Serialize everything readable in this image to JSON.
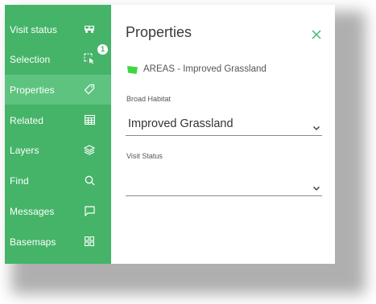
{
  "sidebar": {
    "items": [
      {
        "label": "Visit status",
        "icon": "van-icon",
        "active": false
      },
      {
        "label": "Selection",
        "icon": "select-cursor-icon",
        "active": false,
        "badge": "1"
      },
      {
        "label": "Properties",
        "icon": "tag-icon",
        "active": true
      },
      {
        "label": "Related",
        "icon": "table-icon",
        "active": false
      },
      {
        "label": "Layers",
        "icon": "layers-icon",
        "active": false
      },
      {
        "label": "Find",
        "icon": "search-icon",
        "active": false
      },
      {
        "label": "Messages",
        "icon": "message-icon",
        "active": false
      },
      {
        "label": "Basemaps",
        "icon": "grid-icon",
        "active": false
      }
    ]
  },
  "panel": {
    "title": "Properties",
    "layer_name": "AREAS - Improved Grassland",
    "fields": [
      {
        "label": "Broad Habitat",
        "value": "Improved Grassland"
      },
      {
        "label": "Visit Status",
        "value": ""
      }
    ]
  },
  "colors": {
    "sidebar": "#45b468",
    "sidebar_active": "#5ec37f",
    "accent": "#3cb371",
    "layer_swatch": "#3fd63f"
  }
}
